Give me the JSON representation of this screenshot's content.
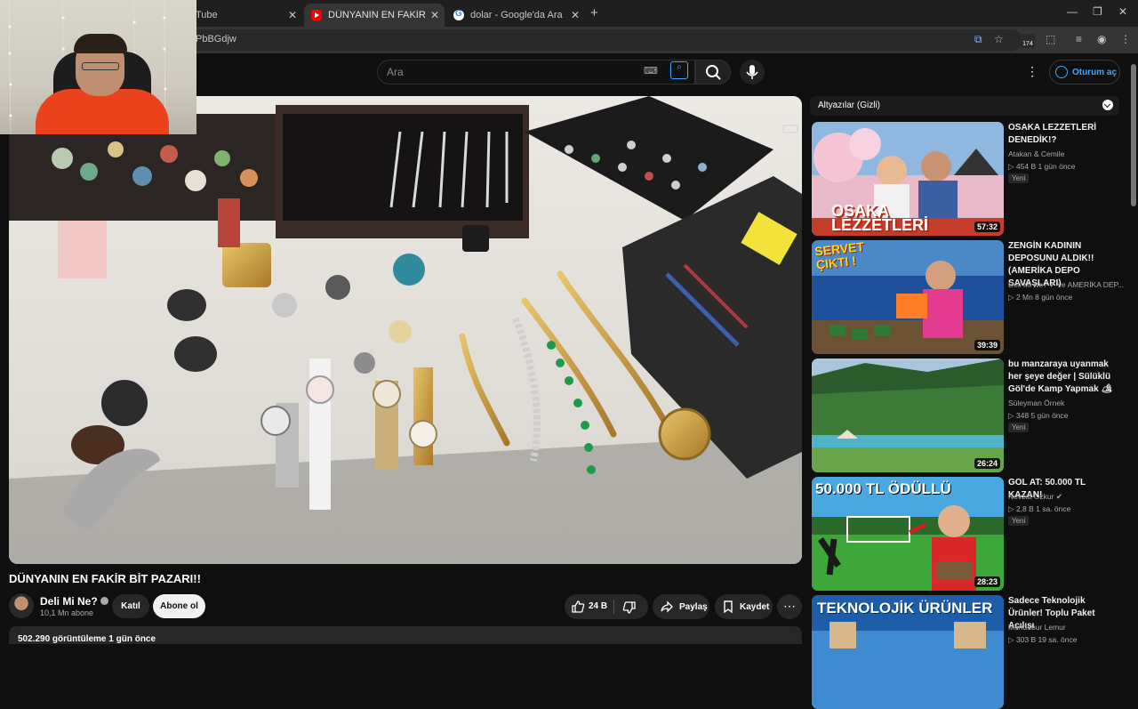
{
  "browser": {
    "tabs": [
      {
        "title": "Tube",
        "active": false
      },
      {
        "title": "DÜNYANIN EN FAKİR BİT P",
        "active": true
      },
      {
        "title": "dolar - Google'da Ara",
        "active": false
      }
    ],
    "url_fragment": "PbBGdjw",
    "extension_badge": "174"
  },
  "masthead": {
    "search_placeholder": "Ara",
    "signin_label": "Oturum aç"
  },
  "video": {
    "title": "DÜNYANIN EN FAKİR BİT PAZARI!!",
    "channel": "Deli Mi Ne?",
    "subscribers": "10,1 Mn abone",
    "join_label": "Katıl",
    "subscribe_label": "Abone ol",
    "likes": "24 B",
    "share_label": "Paylaş",
    "save_label": "Kaydet",
    "views_line": "502.290 görüntüleme  1 gün önce"
  },
  "rail": {
    "chat_header": "Altyazılar (Gizli)",
    "recommendations": [
      {
        "title": "OSAKA LEZZETLERİ DENEDİK!?",
        "channel": "Atakan & Cemile",
        "stats": "▷ 454 B   1 gün önce",
        "badge": "Yeni",
        "duration": "57:32",
        "thumb_text": "OSAKA LEZZETLERİ"
      },
      {
        "title": "ZENGİN KADININ DEPOSUNU ALDIK!! (AMERİKA DEPO SAVAŞLARI)",
        "channel": "Deli Mi Ne? ✔ ve AMERİKA DEP...",
        "stats": "▷ 2 Mn   8 gün önce",
        "badge": "",
        "duration": "39:39",
        "thumb_text": "SERVET ÇIKTI !"
      },
      {
        "title": "bu manzaraya uyanmak her şeye değer | Sülüklü Göl'de Kamp Yapmak 🏕",
        "channel": "Süleyman Örnek",
        "stats": "▷ 348   5 gün önce",
        "badge": "Yeni",
        "duration": "26:24",
        "thumb_text": ""
      },
      {
        "title": "GOL AT: 50.000 TL KAZAN!",
        "channel": "Nevzat Özkur ✔",
        "stats": "▷ 2,8 B   1 sa. önce",
        "badge": "Yeni",
        "duration": "28:23",
        "thumb_text": "50.000 TL ÖDÜLLÜ"
      },
      {
        "title": "Sadece Teknolojik Ürünler! Toplu Paket Açılışı",
        "channel": "Mendebur Lemur",
        "stats": "▷ 303 B   19 sa. önce",
        "badge": "",
        "duration": "",
        "thumb_text": "TEKNOLOJİK ÜRÜNLER"
      }
    ]
  },
  "colors": {
    "accent": "#3ea6ff",
    "youtube_red": "#ff0000",
    "bg": "#0f0f0f"
  },
  "icons": [
    "tab-close-icon",
    "new-tab-icon",
    "minimize-icon",
    "maximize-icon",
    "close-window-icon",
    "translate-icon",
    "star-icon",
    "extensions-icon",
    "profile-icon",
    "search-icon",
    "mic-icon",
    "keyboard-icon",
    "lens-icon",
    "more-vert-icon",
    "like-icon",
    "dislike-icon",
    "share-icon",
    "save-icon",
    "chevron-down-icon"
  ]
}
